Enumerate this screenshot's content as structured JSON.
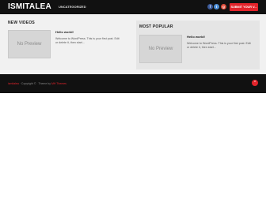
{
  "site": {
    "title": "ISMITALEA"
  },
  "nav": {
    "items": [
      "UNCATEGORIZED"
    ]
  },
  "social": {
    "facebook": "f",
    "twitter": "t",
    "googleplus": "g"
  },
  "header": {
    "submit_label": "SUBMIT YOUR V..."
  },
  "new_videos": {
    "heading": "NEW VIDEOS",
    "post": {
      "thumbnail_text": "No Preview",
      "title": "Hello world!",
      "excerpt": "Welcome to WordPress. This is your first post. Edit or delete it, then start..."
    }
  },
  "most_popular": {
    "heading": "MOST POPULAR",
    "post": {
      "thumbnail_text": "No Preview",
      "title": "Hello world!",
      "excerpt": "Welcome to WordPress. This is your first post. Edit or delete it, then start..."
    }
  },
  "footer": {
    "brand": "ismitalea",
    "copyright": " · Copyright © ",
    "theme_prefix": "Theme by ",
    "theme_name": "MH Themes"
  },
  "scroll_top": {
    "icon": "^"
  },
  "colors": {
    "accent": "#e3242b",
    "dark": "#111111",
    "panel": "#f1f1f1"
  }
}
